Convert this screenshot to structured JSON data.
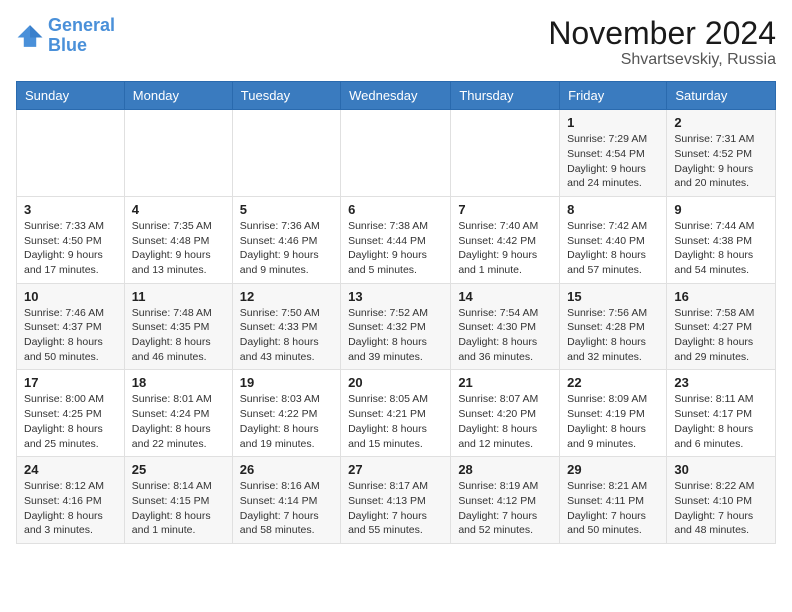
{
  "logo": {
    "line1": "General",
    "line2": "Blue"
  },
  "title": "November 2024",
  "location": "Shvartsevskiy, Russia",
  "weekdays": [
    "Sunday",
    "Monday",
    "Tuesday",
    "Wednesday",
    "Thursday",
    "Friday",
    "Saturday"
  ],
  "weeks": [
    [
      {
        "day": "",
        "info": ""
      },
      {
        "day": "",
        "info": ""
      },
      {
        "day": "",
        "info": ""
      },
      {
        "day": "",
        "info": ""
      },
      {
        "day": "",
        "info": ""
      },
      {
        "day": "1",
        "info": "Sunrise: 7:29 AM\nSunset: 4:54 PM\nDaylight: 9 hours and 24 minutes."
      },
      {
        "day": "2",
        "info": "Sunrise: 7:31 AM\nSunset: 4:52 PM\nDaylight: 9 hours and 20 minutes."
      }
    ],
    [
      {
        "day": "3",
        "info": "Sunrise: 7:33 AM\nSunset: 4:50 PM\nDaylight: 9 hours and 17 minutes."
      },
      {
        "day": "4",
        "info": "Sunrise: 7:35 AM\nSunset: 4:48 PM\nDaylight: 9 hours and 13 minutes."
      },
      {
        "day": "5",
        "info": "Sunrise: 7:36 AM\nSunset: 4:46 PM\nDaylight: 9 hours and 9 minutes."
      },
      {
        "day": "6",
        "info": "Sunrise: 7:38 AM\nSunset: 4:44 PM\nDaylight: 9 hours and 5 minutes."
      },
      {
        "day": "7",
        "info": "Sunrise: 7:40 AM\nSunset: 4:42 PM\nDaylight: 9 hours and 1 minute."
      },
      {
        "day": "8",
        "info": "Sunrise: 7:42 AM\nSunset: 4:40 PM\nDaylight: 8 hours and 57 minutes."
      },
      {
        "day": "9",
        "info": "Sunrise: 7:44 AM\nSunset: 4:38 PM\nDaylight: 8 hours and 54 minutes."
      }
    ],
    [
      {
        "day": "10",
        "info": "Sunrise: 7:46 AM\nSunset: 4:37 PM\nDaylight: 8 hours and 50 minutes."
      },
      {
        "day": "11",
        "info": "Sunrise: 7:48 AM\nSunset: 4:35 PM\nDaylight: 8 hours and 46 minutes."
      },
      {
        "day": "12",
        "info": "Sunrise: 7:50 AM\nSunset: 4:33 PM\nDaylight: 8 hours and 43 minutes."
      },
      {
        "day": "13",
        "info": "Sunrise: 7:52 AM\nSunset: 4:32 PM\nDaylight: 8 hours and 39 minutes."
      },
      {
        "day": "14",
        "info": "Sunrise: 7:54 AM\nSunset: 4:30 PM\nDaylight: 8 hours and 36 minutes."
      },
      {
        "day": "15",
        "info": "Sunrise: 7:56 AM\nSunset: 4:28 PM\nDaylight: 8 hours and 32 minutes."
      },
      {
        "day": "16",
        "info": "Sunrise: 7:58 AM\nSunset: 4:27 PM\nDaylight: 8 hours and 29 minutes."
      }
    ],
    [
      {
        "day": "17",
        "info": "Sunrise: 8:00 AM\nSunset: 4:25 PM\nDaylight: 8 hours and 25 minutes."
      },
      {
        "day": "18",
        "info": "Sunrise: 8:01 AM\nSunset: 4:24 PM\nDaylight: 8 hours and 22 minutes."
      },
      {
        "day": "19",
        "info": "Sunrise: 8:03 AM\nSunset: 4:22 PM\nDaylight: 8 hours and 19 minutes."
      },
      {
        "day": "20",
        "info": "Sunrise: 8:05 AM\nSunset: 4:21 PM\nDaylight: 8 hours and 15 minutes."
      },
      {
        "day": "21",
        "info": "Sunrise: 8:07 AM\nSunset: 4:20 PM\nDaylight: 8 hours and 12 minutes."
      },
      {
        "day": "22",
        "info": "Sunrise: 8:09 AM\nSunset: 4:19 PM\nDaylight: 8 hours and 9 minutes."
      },
      {
        "day": "23",
        "info": "Sunrise: 8:11 AM\nSunset: 4:17 PM\nDaylight: 8 hours and 6 minutes."
      }
    ],
    [
      {
        "day": "24",
        "info": "Sunrise: 8:12 AM\nSunset: 4:16 PM\nDaylight: 8 hours and 3 minutes."
      },
      {
        "day": "25",
        "info": "Sunrise: 8:14 AM\nSunset: 4:15 PM\nDaylight: 8 hours and 1 minute."
      },
      {
        "day": "26",
        "info": "Sunrise: 8:16 AM\nSunset: 4:14 PM\nDaylight: 7 hours and 58 minutes."
      },
      {
        "day": "27",
        "info": "Sunrise: 8:17 AM\nSunset: 4:13 PM\nDaylight: 7 hours and 55 minutes."
      },
      {
        "day": "28",
        "info": "Sunrise: 8:19 AM\nSunset: 4:12 PM\nDaylight: 7 hours and 52 minutes."
      },
      {
        "day": "29",
        "info": "Sunrise: 8:21 AM\nSunset: 4:11 PM\nDaylight: 7 hours and 50 minutes."
      },
      {
        "day": "30",
        "info": "Sunrise: 8:22 AM\nSunset: 4:10 PM\nDaylight: 7 hours and 48 minutes."
      }
    ]
  ]
}
